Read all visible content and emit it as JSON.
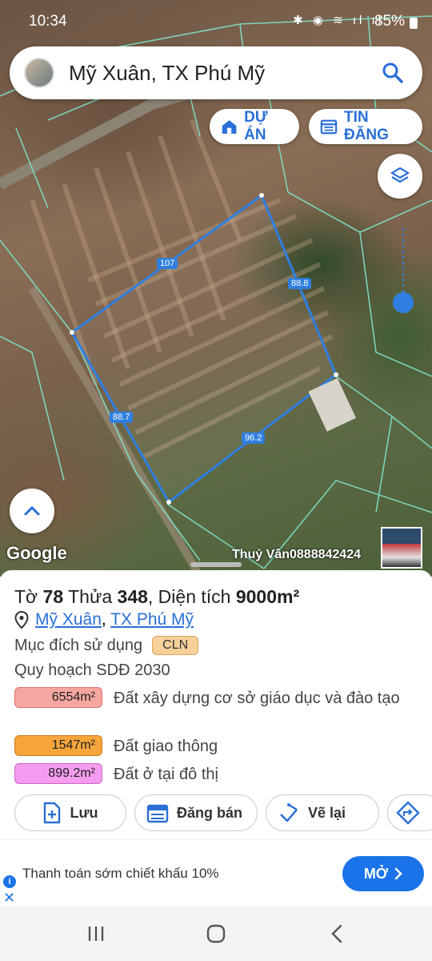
{
  "status": {
    "time": "10:34",
    "battery": "85%"
  },
  "search": {
    "text": "Mỹ Xuân, TX Phú Mỹ"
  },
  "map": {
    "buttons": {
      "du_an": "DỰ ÁN",
      "tin_dang": "TIN ĐĂNG"
    },
    "edges": [
      "107",
      "88.8",
      "96.2",
      "88.7"
    ],
    "google": "Google",
    "watermark": "Thuỷ Vân0888842424"
  },
  "parcel": {
    "title_prefix": "Tờ ",
    "to": "78",
    "mid1": " Thửa ",
    "thua": "348",
    "mid2": ", Diện tích ",
    "area": "9000m²",
    "location_1": "Mỹ Xuân",
    "location_sep": ", ",
    "location_2": "TX Phú Mỹ",
    "purpose_label": "Mục đích sử dụng",
    "purpose_code": "CLN",
    "plan_title": "Quy hoạch SDĐ 2030",
    "zones": [
      {
        "area": "6554m²",
        "label": "Đất xây dựng cơ sở giáo dục và đào tạo",
        "color": "#f6a6a0",
        "border": "#d9726a"
      },
      {
        "area": "1547m²",
        "label": "Đất giao thông",
        "color": "#f5a53a",
        "border": "#c9801e"
      },
      {
        "area": "899.2m²",
        "label": "Đất ở tại đô thị",
        "color": "#f59cf0",
        "border": "#c96ac4"
      }
    ]
  },
  "actions": {
    "save": "Lưu",
    "sell": "Đăng bán",
    "redraw": "Vẽ lại"
  },
  "ad": {
    "text": "Thanh toán sớm chiết khấu 10%",
    "button": "MỞ"
  },
  "colors": {
    "accent": "#2a6fd6",
    "parcel_line": "#2f7fe0",
    "cadastral_line": "#7fe0c8"
  }
}
